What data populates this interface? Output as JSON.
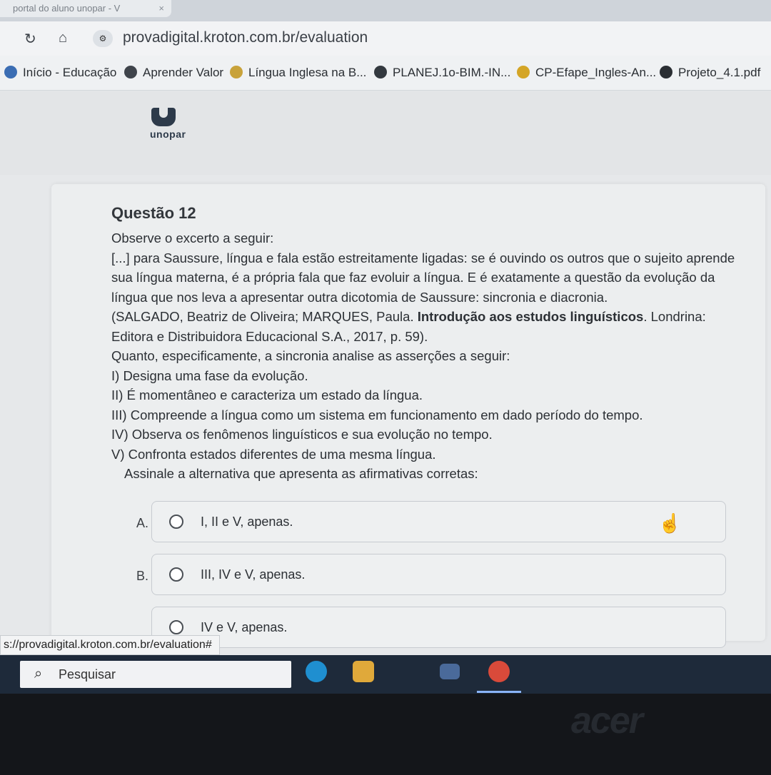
{
  "browser": {
    "tab": {
      "title": "portal do aluno unopar - V",
      "close": "×"
    },
    "url": "provadigital.kroton.com.br/evaluation",
    "bookmarks": [
      {
        "label": "Início - Educação"
      },
      {
        "label": "Aprender Valor"
      },
      {
        "label": "Língua Inglesa na B..."
      },
      {
        "label": "PLANEJ.1o-BIM.-IN..."
      },
      {
        "label": "CP-Efape_Ingles-An..."
      },
      {
        "label": "Projeto_4.1.pdf"
      }
    ],
    "status_url": "s://provadigital.kroton.com.br/evaluation#"
  },
  "header": {
    "logo_text": "unopar"
  },
  "question": {
    "title": "Questão 12",
    "intro": "Observe o excerto a seguir:",
    "excerpt_main": "[...] para Saussure, língua e fala estão estreitamente ligadas: se é ouvindo os outros que o sujeito aprende sua língua materna, é a própria fala que faz evoluir a língua. E é exatamente a questão da evolução da língua que nos leva a apresentar outra dicotomia de Saussure: sincronia e diacronia.",
    "citation_prefix": "(SALGADO, Beatriz de Oliveira; MARQUES, Paula.",
    "citation_title": "Introdução aos estudos linguísticos",
    "citation_suffix": ". Londrina: Editora e Distribuidora Educacional S.A., 2017, p. 59).",
    "prompt": "Quanto, especificamente, a sincronia analise as asserções a seguir:",
    "assertions": [
      "I) Designa uma fase da evolução.",
      "II) É momentâneo e caracteriza um estado da língua.",
      "III) Compreende a língua como um sistema em funcionamento em dado período do tempo.",
      "IV) Observa os fenômenos linguísticos e sua evolução no tempo.",
      "V) Confronta estados diferentes de uma mesma língua."
    ],
    "instruction": "Assinale a alternativa que apresenta as afirmativas corretas:",
    "options": [
      {
        "letter": "A.",
        "text": "I, II e V, apenas."
      },
      {
        "letter": "B.",
        "text": "III, IV e V, apenas."
      },
      {
        "letter": "",
        "text": "IV e V, apenas."
      }
    ]
  },
  "taskbar": {
    "search_placeholder": "Pesquisar"
  },
  "bezel": {
    "brand": "acer"
  },
  "colors": {
    "taskbar": "#1e2a3a",
    "page_bg": "#e6e8ea",
    "card_bg": "#eceeef"
  }
}
